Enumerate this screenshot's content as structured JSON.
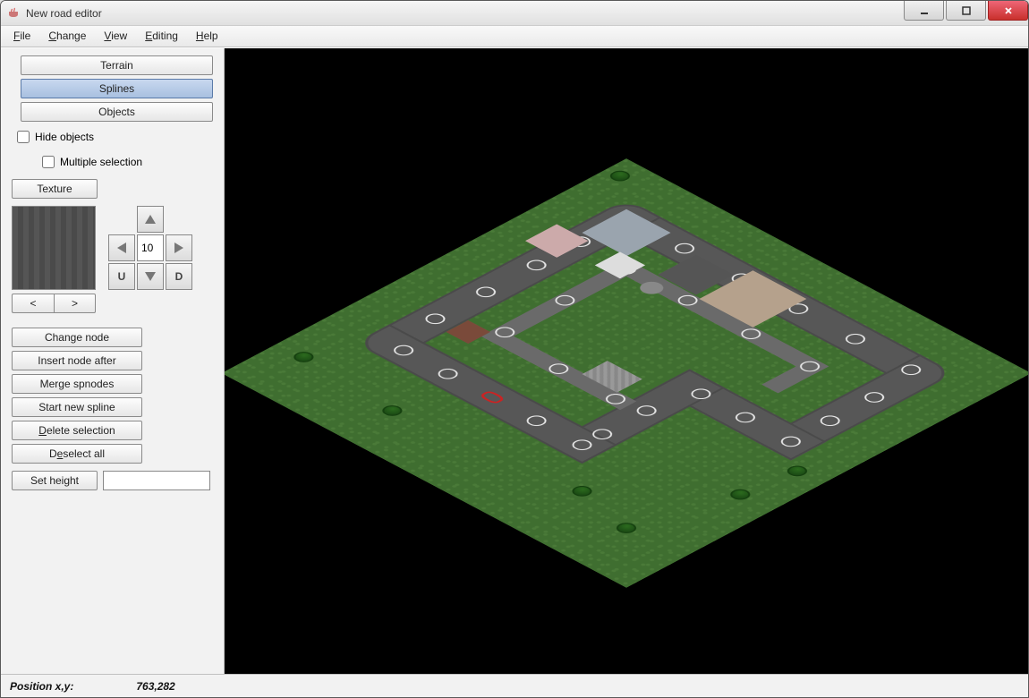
{
  "window": {
    "title": "New road editor"
  },
  "menubar": {
    "items": [
      {
        "label": "File",
        "mnemonic_index": 0
      },
      {
        "label": "Change",
        "mnemonic_index": 0
      },
      {
        "label": "View",
        "mnemonic_index": 0
      },
      {
        "label": "Editing",
        "mnemonic_index": 0
      },
      {
        "label": "Help",
        "mnemonic_index": 0
      }
    ]
  },
  "sidebar": {
    "mode_buttons": {
      "terrain": "Terrain",
      "splines": "Splines",
      "objects": "Objects",
      "active": "splines"
    },
    "hide_objects": {
      "label": "Hide objects",
      "checked": false
    },
    "multiple_selection": {
      "label": "Multiple selection",
      "checked": false
    },
    "texture_button": "Texture",
    "dpad": {
      "value": "10",
      "u_label": "U",
      "d_label": "D"
    },
    "tex_nav": {
      "prev": "<",
      "next": ">"
    },
    "actions": {
      "change_node": "Change node",
      "insert_node_after": "Insert node after",
      "merge_spnodes": "Merge spnodes",
      "start_new_spline": "Start new spline",
      "delete_selection": "Delete selection",
      "deselect_all": "Deselect all",
      "set_height": "Set height"
    },
    "set_height_value": ""
  },
  "statusbar": {
    "label": "Position x,y:",
    "value": "763,282"
  }
}
